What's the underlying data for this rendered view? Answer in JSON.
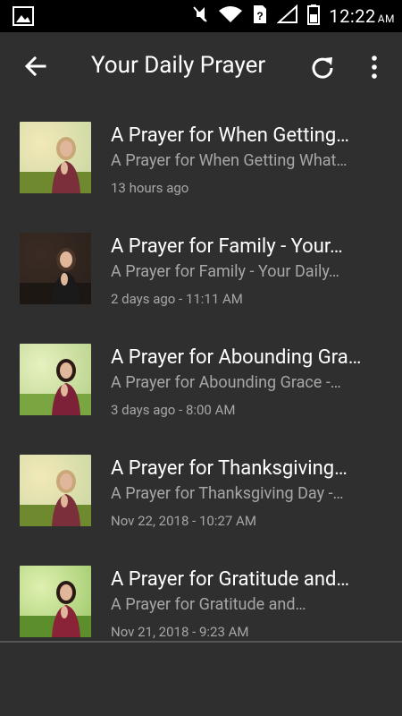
{
  "status_bar": {
    "time": "12:22",
    "ampm": "AM",
    "icons": [
      "image-icon",
      "mute-icon",
      "wifi-icon",
      "sim-unknown-icon",
      "signal-icon",
      "battery-icon"
    ]
  },
  "app_bar": {
    "title": "Your Daily Prayer",
    "back_icon": "arrow-back-icon",
    "refresh_icon": "refresh-icon",
    "more_icon": "more-vert-icon"
  },
  "prayers": [
    {
      "title": "A Prayer for When Getting…",
      "subtitle": "A Prayer for When Getting What…",
      "time": "13 hours ago",
      "thumb": {
        "sky": "#c9d7a3",
        "ground": "#6f8a2e",
        "figure": "#7a2f3a",
        "hair": "#c9a777",
        "bokeh": "#f2e9b8"
      }
    },
    {
      "title": "A Prayer for Family - Your…",
      "subtitle": "A Prayer for Family - Your Daily…",
      "time": "2 days ago - 11:11 AM",
      "thumb": {
        "sky": "#2a201b",
        "ground": "#1d1714",
        "figure": "#1a1a1a",
        "hair": "#4b3428",
        "bokeh": "#3a2c24"
      }
    },
    {
      "title": "A Prayer for Abounding Gra…",
      "subtitle": "A Prayer for Abounding Grace -…",
      "time": "3 days ago - 8:00 AM",
      "thumb": {
        "sky": "#b7d189",
        "ground": "#7aa641",
        "figure": "#7d2138",
        "hair": "#2b1a14",
        "bokeh": "#e6f1c0"
      }
    },
    {
      "title": "A Prayer for Thanksgiving…",
      "subtitle": "A Prayer for Thanksgiving Day -…",
      "time": "Nov 22, 2018 - 10:27 AM",
      "thumb": {
        "sky": "#c9d7a3",
        "ground": "#6f8a2e",
        "figure": "#7a2f3a",
        "hair": "#c9a777",
        "bokeh": "#f2e9b8"
      }
    },
    {
      "title": "A Prayer for Gratitude and…",
      "subtitle": "A Prayer for Gratitude and…",
      "time": "Nov 21, 2018 - 9:23 AM",
      "thumb": {
        "sky": "#9fc96b",
        "ground": "#5c8f2c",
        "figure": "#8a2238",
        "hair": "#2b1a14",
        "bokeh": "#dff0b0"
      }
    }
  ]
}
